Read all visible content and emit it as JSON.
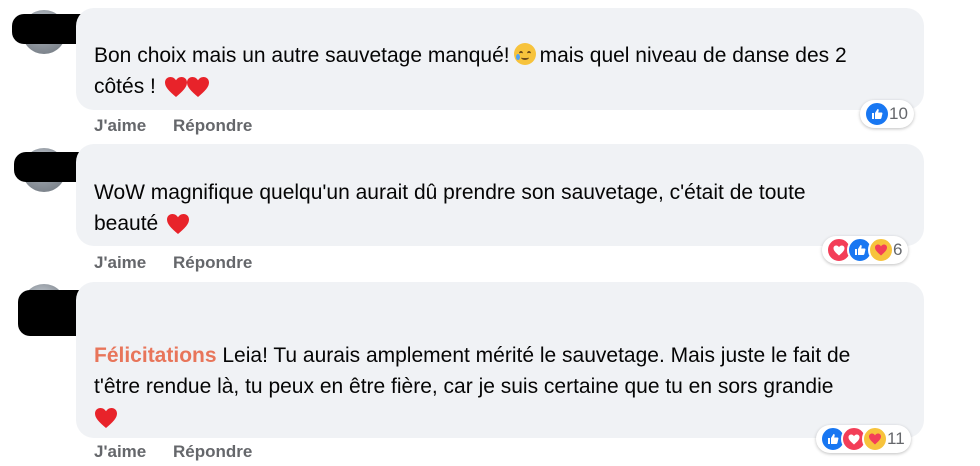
{
  "comments": [
    {
      "text": "Bon choix mais un autre sauvetage manqué!",
      "text_after_emoji": "mais quel niveau de danse des 2",
      "text_line2": "côtés !",
      "actions": {
        "like": "J'aime",
        "reply": "Répondre"
      },
      "reaction_count": "10"
    },
    {
      "text": "WoW magnifique quelqu'un aurait dû prendre son sauvetage, c'était de toute",
      "text_line2": "beauté",
      "actions": {
        "like": "J'aime",
        "reply": "Répondre"
      },
      "reaction_count": "6"
    },
    {
      "mention": "Félicitations",
      "text": "Leia! Tu aurais amplement mérité le sauvetage. Mais juste le fait de",
      "text_line2": "t'être rendue là, tu peux en être fière, car je suis certaine que tu en sors grandie",
      "actions": {
        "like": "J'aime",
        "reply": "Répondre"
      },
      "reaction_count": "11"
    }
  ],
  "colors": {
    "bubble": "#f0f2f5",
    "like": "#1877f2",
    "love": "#f33e58",
    "mention": "#e8755a",
    "secondary_text": "#65676b"
  }
}
